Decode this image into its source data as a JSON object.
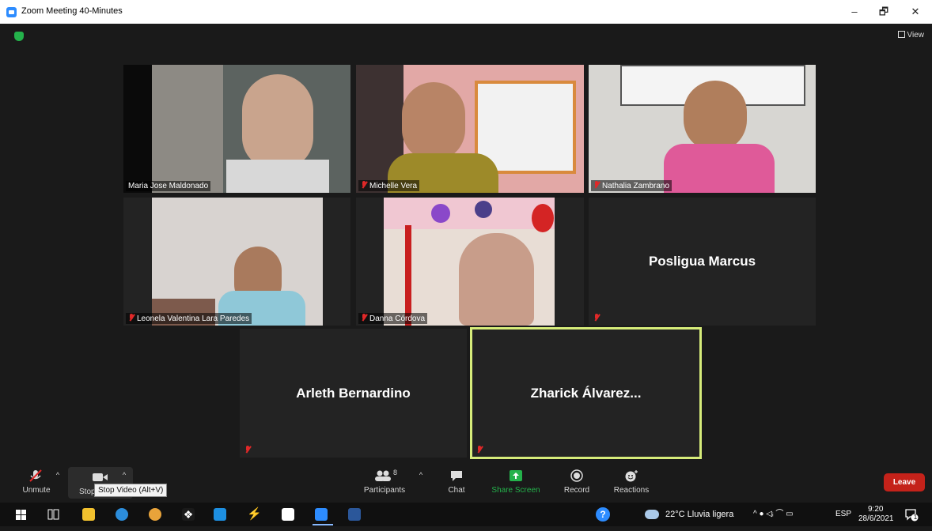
{
  "window": {
    "title": "Zoom Meeting 40-Minutes",
    "minimize": "–",
    "maximize": "🗗",
    "close": "✕"
  },
  "meeting": {
    "view_label": "View"
  },
  "participants": [
    {
      "name": "Maria Jose Maldonado",
      "muted": false
    },
    {
      "name": "Michelle Vera",
      "muted": true
    },
    {
      "name": "Nathalia Zambrano",
      "muted": true
    },
    {
      "name": "Leonela Valentina Lara Paredes",
      "muted": true
    },
    {
      "name": "Danna Córdova",
      "muted": true
    },
    {
      "name": "Posligua Marcus",
      "muted": true
    },
    {
      "name": "Arleth Bernardino",
      "muted": true
    },
    {
      "name": "Zharick Álvarez...",
      "muted": true,
      "active_speaker": true
    }
  ],
  "toolbar": {
    "unmute": "Unmute",
    "stop_video": "Stop",
    "participants": "Participants",
    "participants_count": "8",
    "chat": "Chat",
    "share_screen": "Share Screen",
    "record": "Record",
    "reactions": "Reactions",
    "leave": "Leave",
    "tooltip": "Stop Video (Alt+V)"
  },
  "taskbar": {
    "weather": "22°C  Lluvia ligera",
    "lang": "ESP",
    "time": "9:20",
    "date": "28/6/2021",
    "notif_count": "1"
  },
  "colors": {
    "active_border": "#d6ec7a",
    "leave_red": "#c4221a",
    "share_green": "#24b24b",
    "zoom_blue": "#2d8cff"
  }
}
